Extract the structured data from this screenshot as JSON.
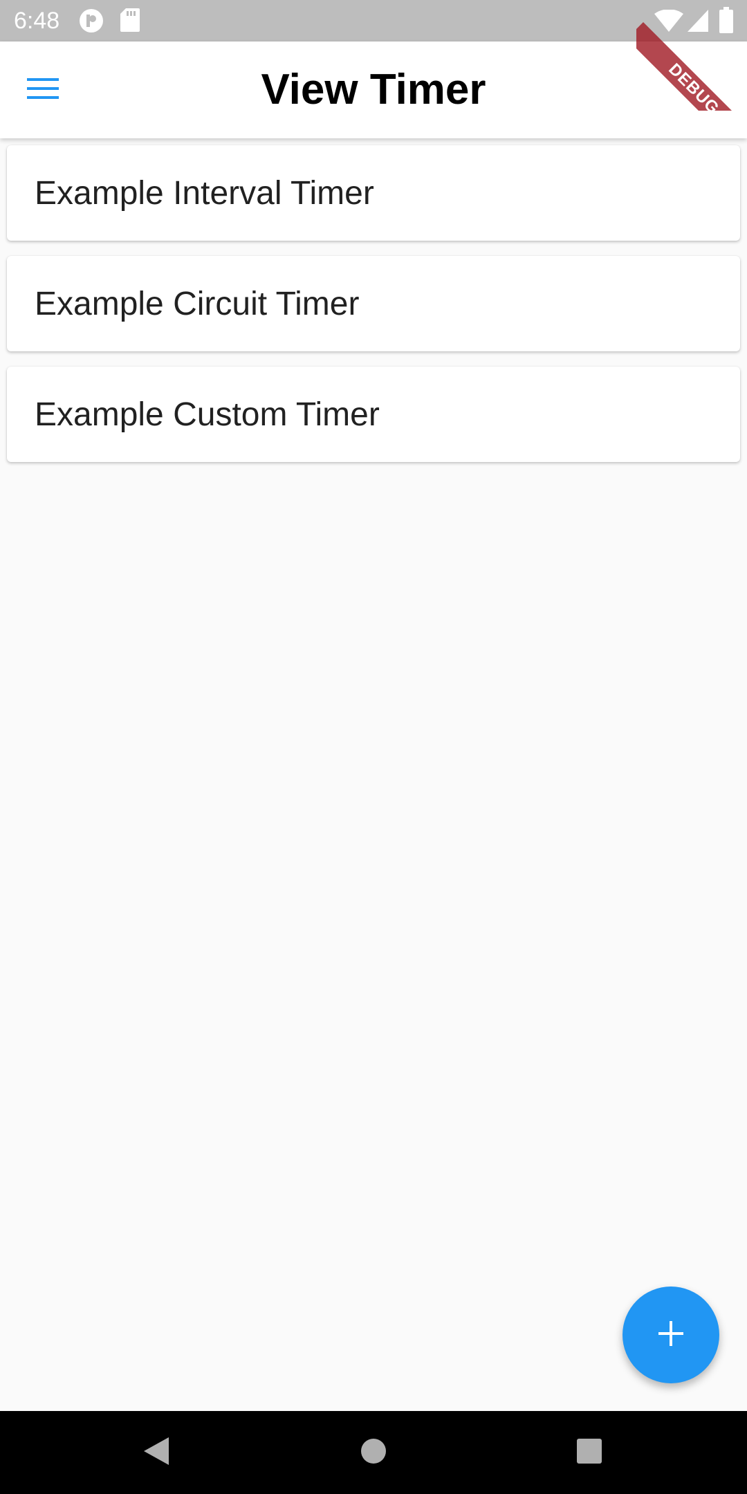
{
  "status_bar": {
    "time": "6:48",
    "left_icons": [
      "pocket-casts-icon",
      "sd-card-icon"
    ],
    "right_icons": [
      "wifi-icon",
      "cell-signal-icon",
      "battery-icon"
    ]
  },
  "app_bar": {
    "title": "View Timer",
    "menu_icon": "menu-icon",
    "accent_color": "#2196f3"
  },
  "timers": [
    {
      "label": "Example Interval Timer"
    },
    {
      "label": "Example Circuit Timer"
    },
    {
      "label": "Example Custom Timer"
    }
  ],
  "fab": {
    "icon": "plus-icon",
    "color": "#2196f3"
  },
  "debug_banner": {
    "label": "DEBUG"
  },
  "nav_bar": {
    "icons": [
      "back-icon",
      "home-icon",
      "recents-icon"
    ]
  }
}
